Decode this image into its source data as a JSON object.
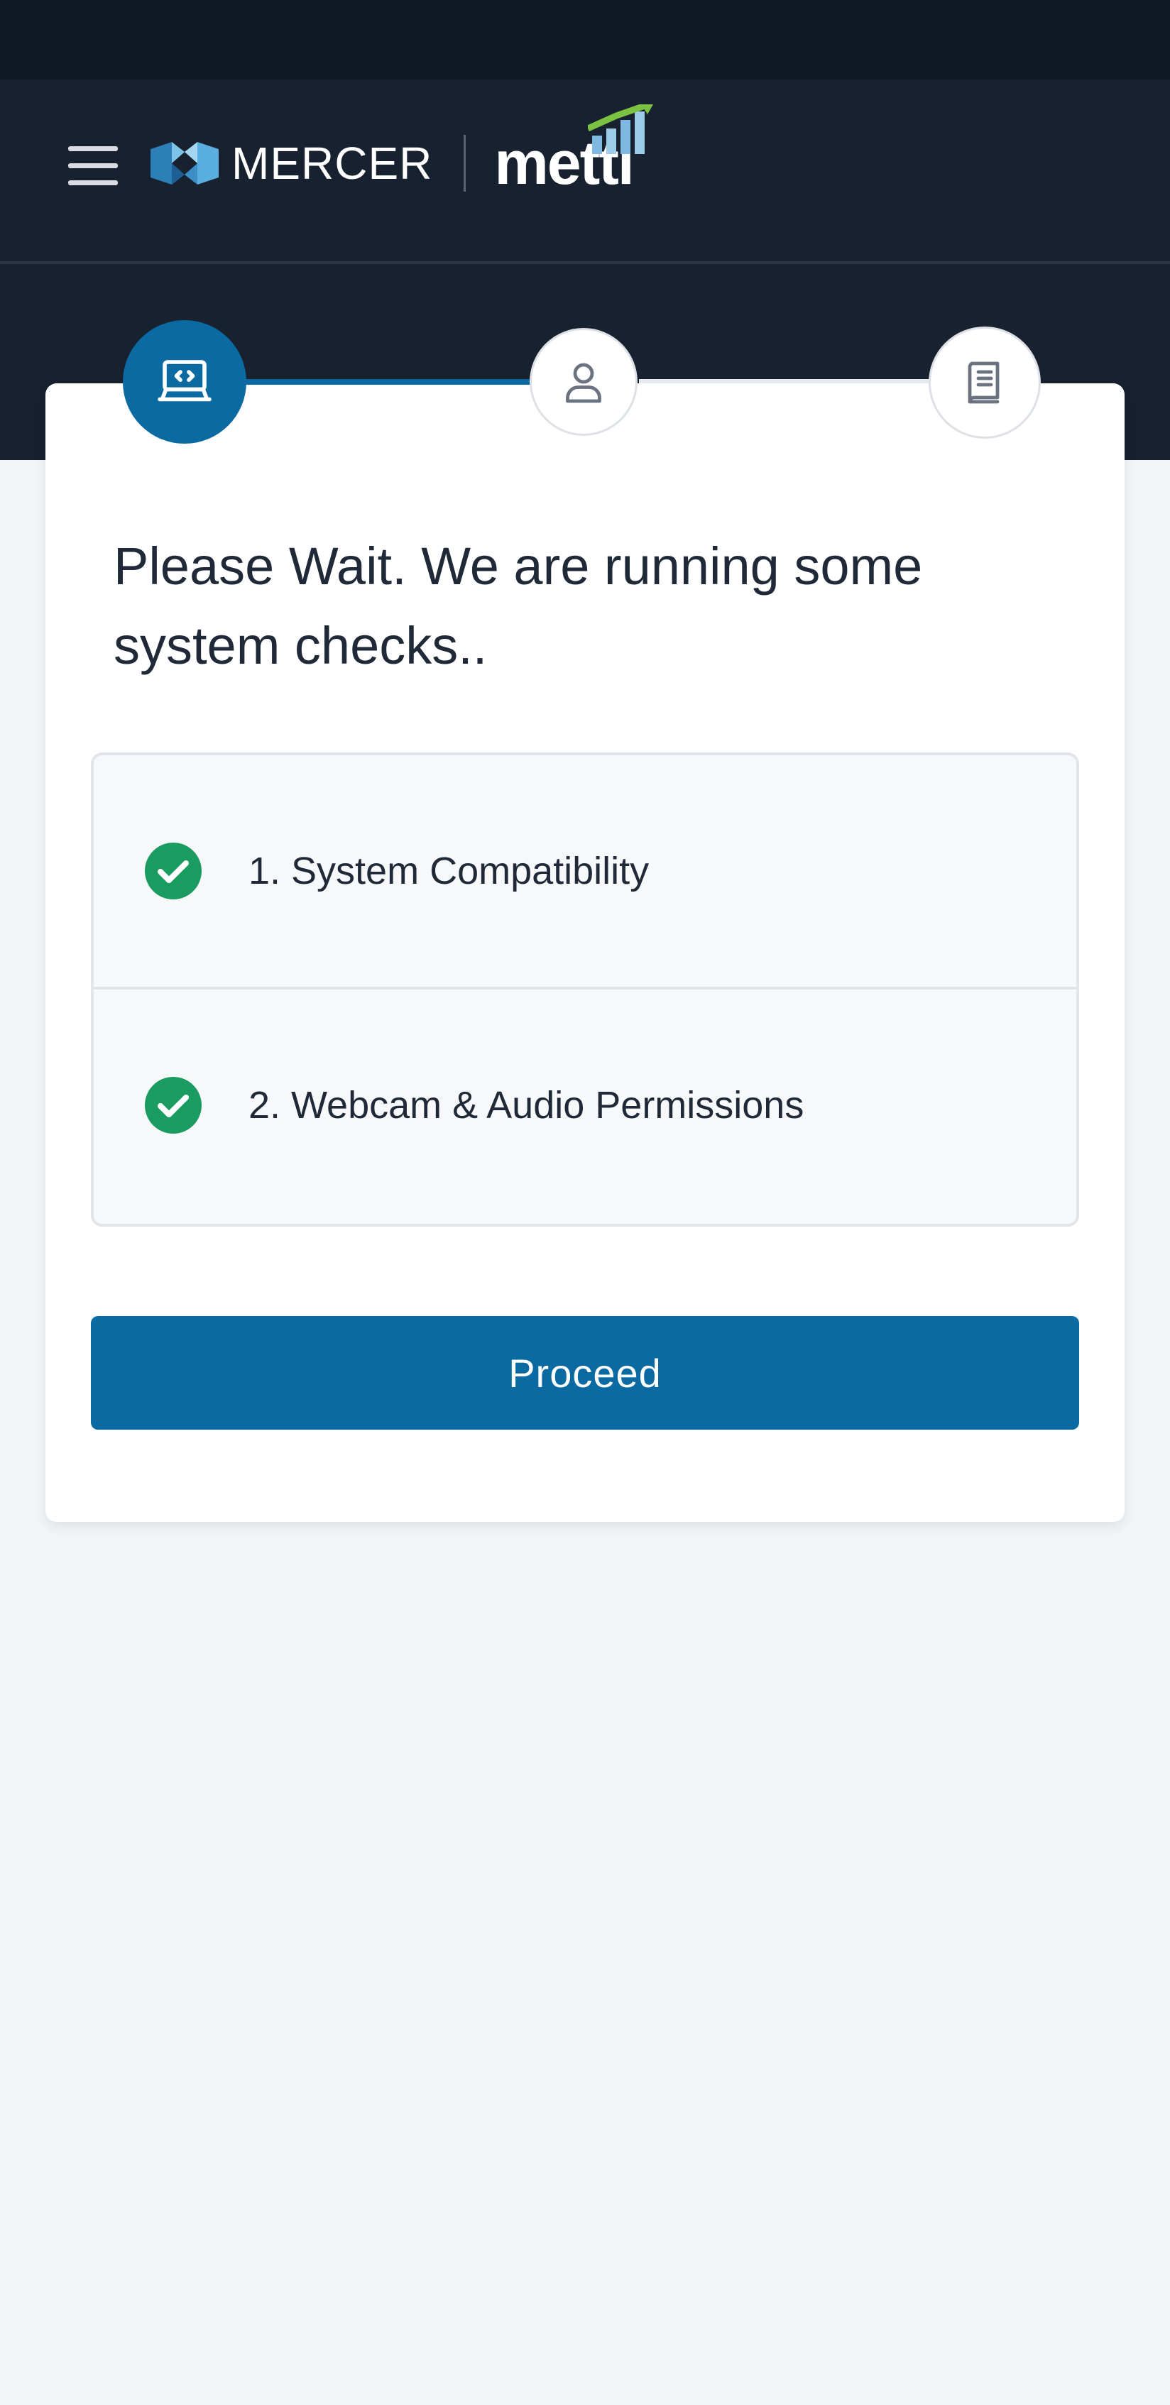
{
  "header": {
    "menu_icon": "hamburger-menu-icon",
    "brand_primary": "MERCER",
    "brand_secondary": "mettl"
  },
  "stepper": {
    "steps": [
      {
        "icon": "laptop-code-icon",
        "status": "active"
      },
      {
        "icon": "user-icon",
        "status": "pending"
      },
      {
        "icon": "book-icon",
        "status": "pending"
      }
    ]
  },
  "main": {
    "title": "Please Wait. We are running some system checks..",
    "checks": [
      {
        "label": "1. System Compatibility",
        "status": "passed",
        "icon": "check-circle-icon"
      },
      {
        "label": "2. Webcam & Audio Permissions",
        "status": "passed",
        "icon": "check-circle-icon"
      }
    ],
    "proceed_label": "Proceed"
  },
  "colors": {
    "header_bg": "#18212f",
    "accent": "#0a6aa1",
    "success": "#1a9b5f",
    "page_bg": "#f3f5f8"
  }
}
